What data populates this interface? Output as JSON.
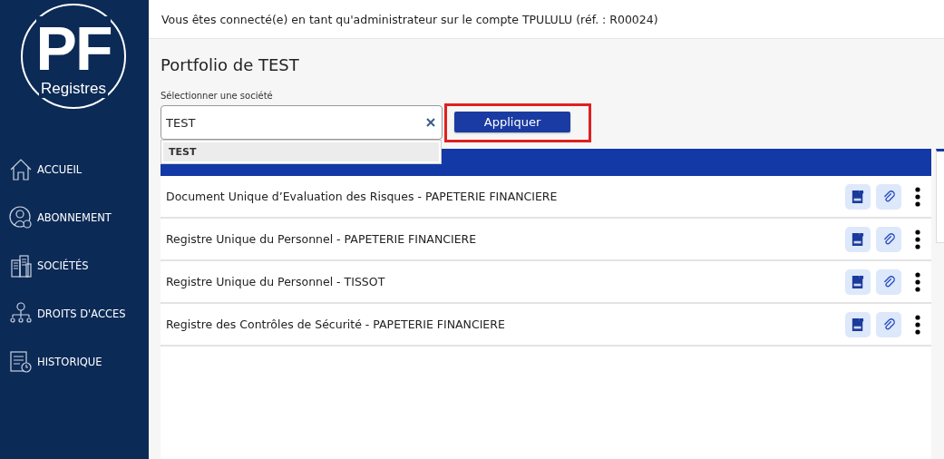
{
  "logo": {
    "letters": "PF",
    "word": "Registres"
  },
  "sidebar": {
    "items": [
      {
        "label": "ACCUEIL",
        "kind": "home"
      },
      {
        "label": "ABONNEMENT",
        "kind": "user"
      },
      {
        "label": "SOCIÉTÉS",
        "kind": "building"
      },
      {
        "label": "DROITS D'ACCES",
        "kind": "team"
      },
      {
        "label": "HISTORIQUE",
        "kind": "history"
      }
    ]
  },
  "top_bar": {
    "text": "Vous êtes connecté(e) en tant qu'administrateur sur le compte TPULULU (réf. : R00024)"
  },
  "page_title": "Portfolio de TEST",
  "company_select": {
    "label": "Sélectionner une société",
    "value": "TEST",
    "options": [
      {
        "label": "TEST",
        "selected": true
      }
    ]
  },
  "apply_button": {
    "label": "Appliquer",
    "highlighted": true
  },
  "registers": [
    {
      "name": "Document Unique d’Evaluation des Risques - PAPETERIE FINANCIERE"
    },
    {
      "name": "Registre Unique du Personnel - PAPETERIE FINANCIERE"
    },
    {
      "name": "Registre Unique du Personnel - TISSOT"
    },
    {
      "name": "Registre des Contrôles de Sécurité - PAPETERIE FINANCIERE"
    }
  ]
}
